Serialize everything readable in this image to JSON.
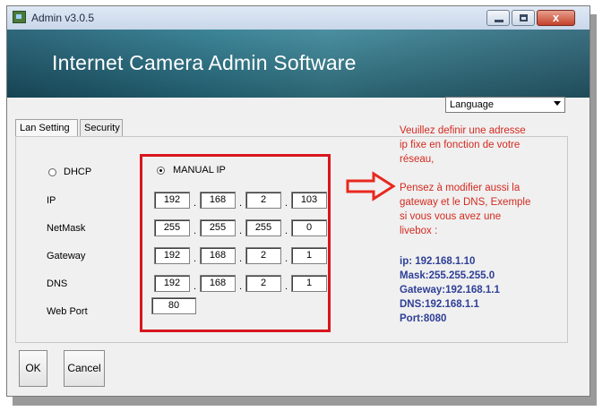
{
  "window": {
    "title": "Admin v3.0.5",
    "minimize_glyph": "minimize-icon",
    "maximize_glyph": "maximize-icon",
    "close_glyph": "x"
  },
  "banner": {
    "title": "Internet Camera Admin Software"
  },
  "language": {
    "selected": "Language"
  },
  "tabs": [
    {
      "label": "Lan Setting"
    },
    {
      "label": "Security"
    }
  ],
  "network": {
    "dhcp_label": "DHCP",
    "manual_label": "MANUAL IP",
    "mode": "MANUAL IP",
    "rows": [
      {
        "label": "IP",
        "octets": [
          "192",
          "168",
          "2",
          "103"
        ]
      },
      {
        "label": "NetMask",
        "octets": [
          "255",
          "255",
          "255",
          "0"
        ]
      },
      {
        "label": "Gateway",
        "octets": [
          "192",
          "168",
          "2",
          "1"
        ]
      },
      {
        "label": "DNS",
        "octets": [
          "192",
          "168",
          "2",
          "1"
        ]
      }
    ],
    "web_port_label": "Web Port",
    "web_port": "80",
    "separator": "."
  },
  "annotation": {
    "red_lines": [
      "Veuillez definir une adresse",
      "ip fixe en fonction de votre",
      "réseau,",
      "",
      "Pensez à modifier aussi la",
      "gateway et le DNS, Exemple",
      "si vous vous avez une",
      "livebox :"
    ],
    "blue_lines": [
      "ip: 192.168.1.10",
      "Mask:255.255.255.0",
      "Gateway:192.168.1.1",
      "DNS:192.168.1.1",
      "Port:8080"
    ],
    "arrow_color": "#e8281e",
    "box_color": "#d8161d"
  },
  "buttons": {
    "ok": "OK",
    "cancel": "Cancel"
  }
}
